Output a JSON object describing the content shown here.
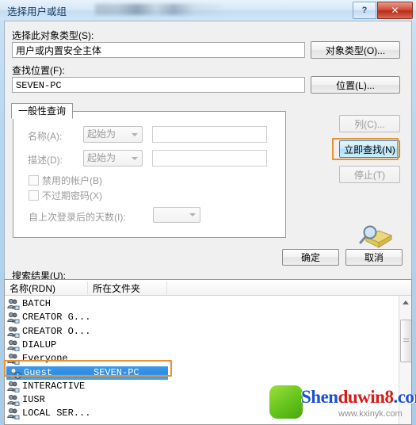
{
  "window": {
    "title": "选择用户或组",
    "blurred_subtitle": "",
    "help_button": "?",
    "close_button": "✕"
  },
  "object_type": {
    "label": "选择此对象类型(S):",
    "value": "用户或内置安全主体",
    "button": "对象类型(O)..."
  },
  "location": {
    "label": "查找位置(F):",
    "value": "SEVEN-PC",
    "button": "位置(L)..."
  },
  "query": {
    "tab_label": "一般性查询",
    "name_label": "名称(A):",
    "name_condition": "起始为",
    "name_value": "",
    "desc_label": "描述(D):",
    "desc_condition": "起始为",
    "desc_value": "",
    "disabled_accounts_label": "禁用的帐户(B)",
    "non_expiring_password_label": "不过期密码(X)",
    "days_since_login_label": "自上次登录后的天数(I):",
    "days_since_login_value": ""
  },
  "side_buttons": {
    "columns": "列(C)...",
    "find_now": "立即查找(N)",
    "stop": "停止(T)"
  },
  "dialog_buttons": {
    "ok": "确定",
    "cancel": "取消"
  },
  "results": {
    "label": "搜索结果(U):",
    "columns": [
      "名称(RDN)",
      "所在文件夹",
      ""
    ],
    "rows": [
      {
        "name": "BATCH",
        "folder": "",
        "selected": false
      },
      {
        "name": "CREATOR G...",
        "folder": "",
        "selected": false
      },
      {
        "name": "CREATOR O...",
        "folder": "",
        "selected": false
      },
      {
        "name": "DIALUP",
        "folder": "",
        "selected": false
      },
      {
        "name": "Everyone",
        "folder": "",
        "selected": false
      },
      {
        "name": "Guest",
        "folder": "SEVEN-PC",
        "selected": true
      },
      {
        "name": "INTERACTIVE",
        "folder": "",
        "selected": false
      },
      {
        "name": "IUSR",
        "folder": "",
        "selected": false
      },
      {
        "name": "LOCAL SER...",
        "folder": "",
        "selected": false
      }
    ]
  },
  "watermark": {
    "text_blue_1": "Shen",
    "text_red": "duwin8",
    "text_blue_2": ".com",
    "sub": "www.kxinyk.com"
  },
  "colors": {
    "annotation": "#e8922f",
    "selection": "#2f8ce4",
    "close_button": "#c4341f",
    "watermark_blue": "#1a4fd6",
    "watermark_red": "#d61a1a"
  }
}
